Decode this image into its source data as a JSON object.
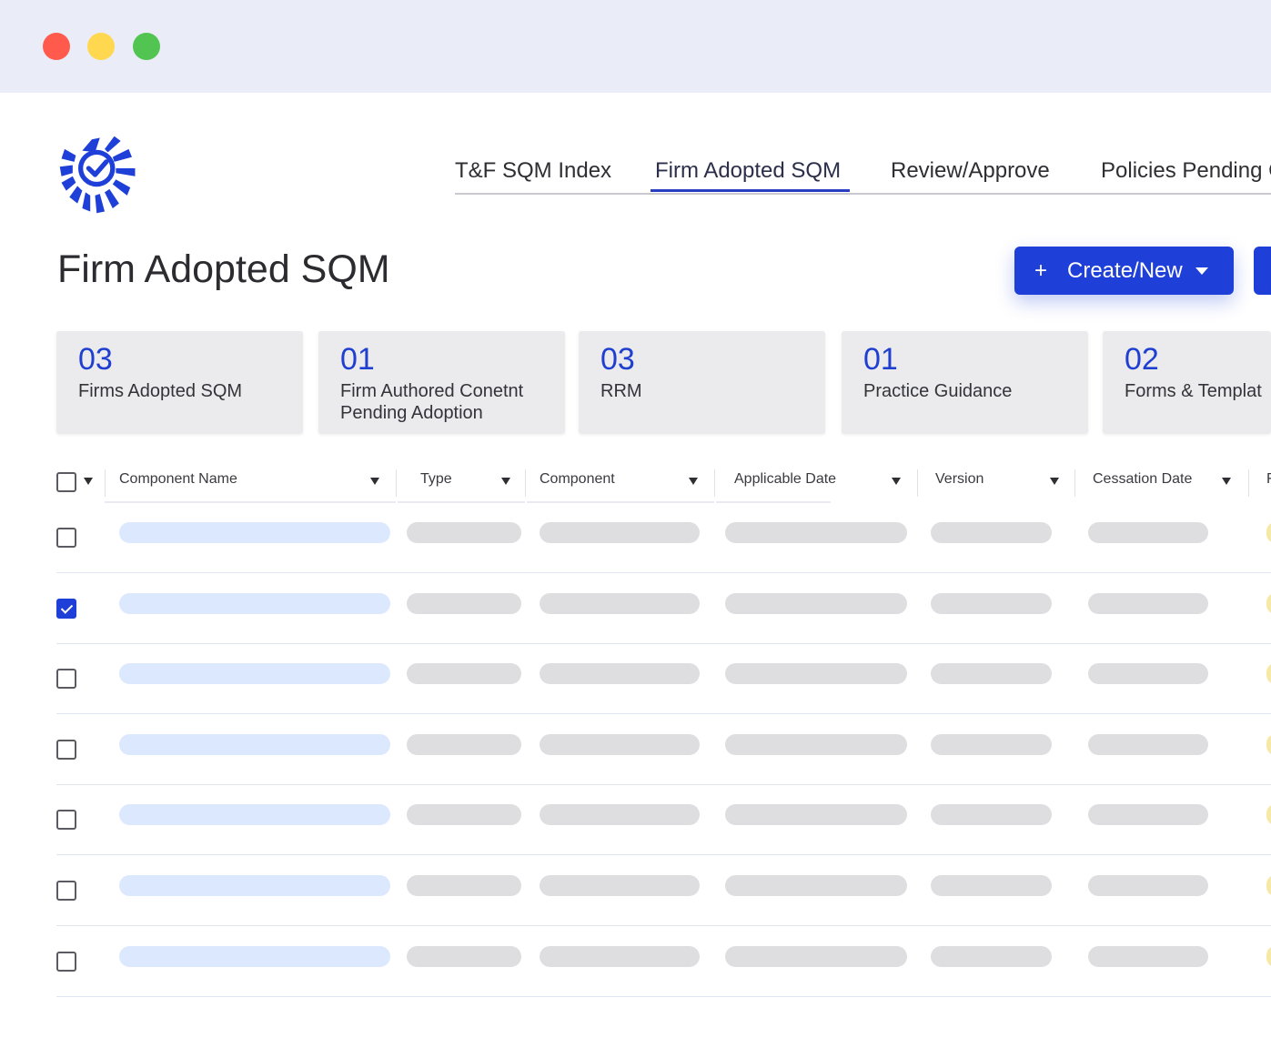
{
  "window": {
    "controls": [
      "close",
      "minimize",
      "maximize"
    ]
  },
  "logo": {
    "icon": "checkmark-sunburst-logo-icon",
    "color": "#1e3fd8"
  },
  "nav": {
    "tabs": [
      {
        "label": "T&F SQM Index",
        "active": false
      },
      {
        "label": "Firm Adopted SQM",
        "active": true
      },
      {
        "label": "Review/Approve",
        "active": false
      },
      {
        "label": "Policies Pending C",
        "active": false
      }
    ]
  },
  "page": {
    "title": "Firm Adopted SQM"
  },
  "actions": {
    "create_label": "Create/New",
    "create_icon": "plus-icon"
  },
  "cards": [
    {
      "count": "03",
      "label": "Firms Adopted SQM"
    },
    {
      "count": "01",
      "label": "Firm Authored Conetnt Pending Adoption"
    },
    {
      "count": "03",
      "label": "RRM"
    },
    {
      "count": "01",
      "label": "Practice Guidance"
    },
    {
      "count": "02",
      "label": "Forms & Templat"
    }
  ],
  "table": {
    "columns": [
      "Component Name",
      "Type",
      "Component",
      "Applicable Date",
      "Version",
      "Cessation Date",
      "F"
    ],
    "rows": [
      {
        "checked": false
      },
      {
        "checked": true
      },
      {
        "checked": false
      },
      {
        "checked": false
      },
      {
        "checked": false
      },
      {
        "checked": false
      },
      {
        "checked": false
      }
    ]
  },
  "colors": {
    "accent": "#1e3fd8",
    "titlebar": "#eaedf7",
    "card_bg": "#ebebed",
    "name_placeholder": "#dbe8fd",
    "cell_placeholder": "#dedde0",
    "status_placeholder": "#f6e9a6"
  }
}
